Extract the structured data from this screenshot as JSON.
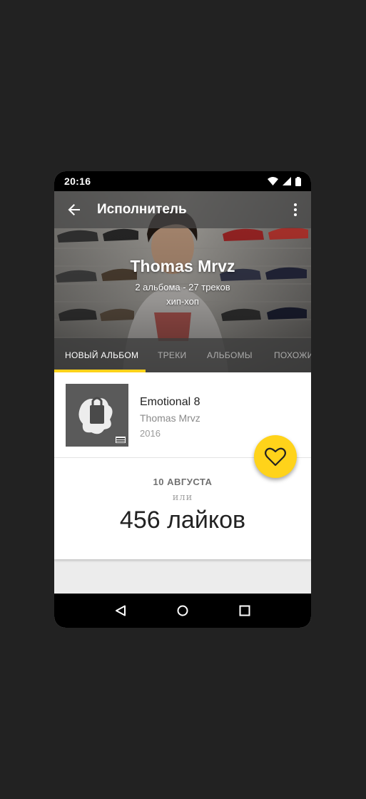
{
  "status_bar": {
    "time": "20:16"
  },
  "app_bar": {
    "title": "Исполнитель"
  },
  "artist": {
    "name": "Thomas Mrvz",
    "meta": "2 альбома - 27 треков",
    "genre": "хип-хоп"
  },
  "tabs": [
    {
      "label": "НОВЫЙ АЛЬБОМ",
      "active": true
    },
    {
      "label": "ТРЕКИ",
      "active": false
    },
    {
      "label": "АЛЬБОМЫ",
      "active": false
    },
    {
      "label": "ПОХОЖИЕ",
      "active": false
    }
  ],
  "new_album": {
    "title": "Emotional 8",
    "artist": "Thomas Mrvz",
    "year": "2016"
  },
  "release": {
    "date": "10 АВГУСТА",
    "or": "или",
    "likes": "456 лайков"
  },
  "colors": {
    "accent": "#ffd31a",
    "background": "#222222",
    "status_bar": "#000000"
  },
  "icons": [
    "back-arrow-icon",
    "more-vert-icon",
    "heart-icon",
    "wifi-icon",
    "signal-icon",
    "battery-icon",
    "nav-back-icon",
    "nav-home-icon",
    "nav-recents-icon"
  ]
}
